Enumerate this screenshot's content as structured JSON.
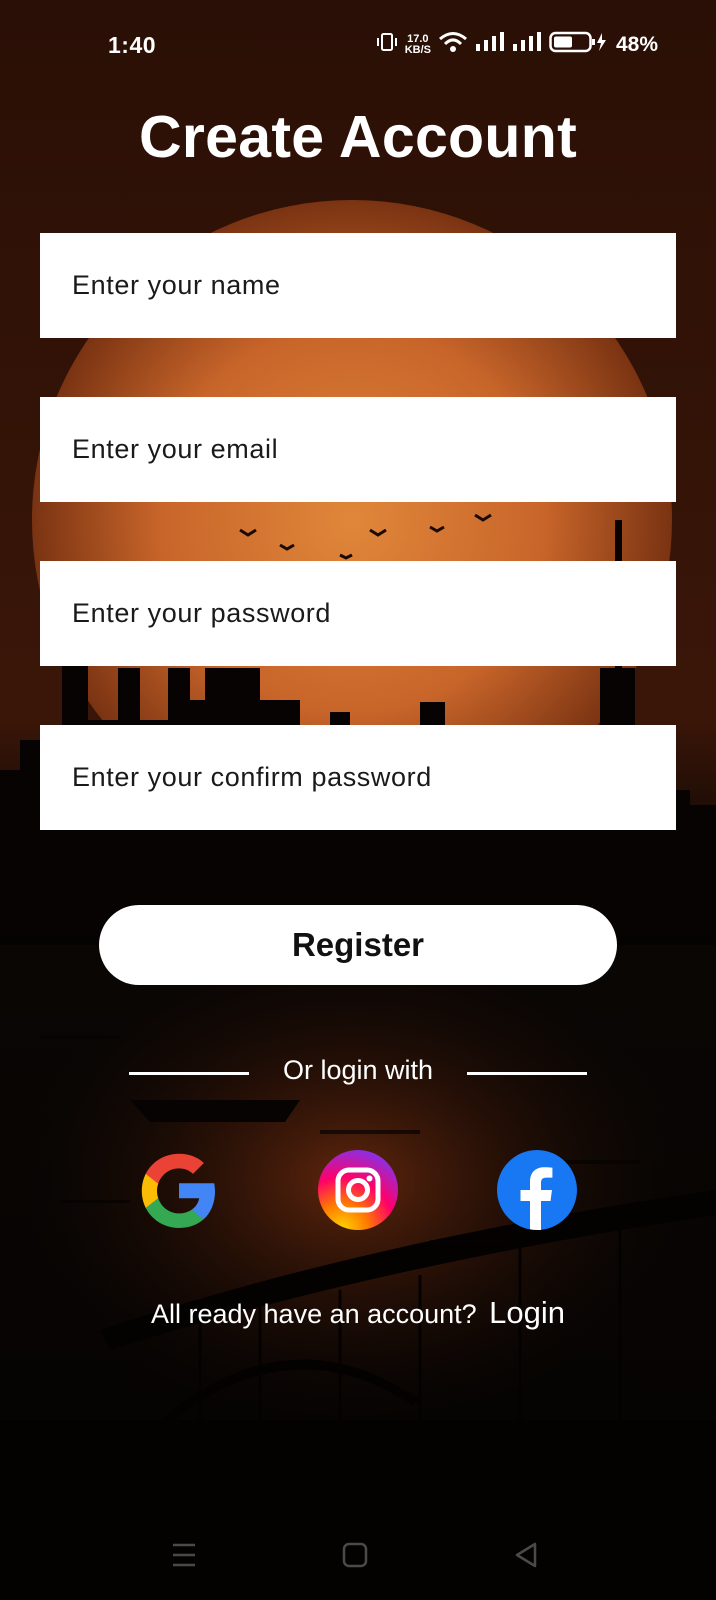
{
  "status_bar": {
    "time": "1:40",
    "net_speed_value": "17.0",
    "net_speed_unit": "KB/S",
    "battery_percent": "48%"
  },
  "page": {
    "title": "Create Account"
  },
  "form": {
    "name_placeholder": "Enter your name",
    "email_placeholder": "Enter your email",
    "password_placeholder": "Enter your password",
    "confirm_password_placeholder": "Enter your confirm password",
    "register_label": "Register"
  },
  "social": {
    "divider_text": "Or login with",
    "providers": [
      {
        "name": "google-icon",
        "color": "#4285F4"
      },
      {
        "name": "instagram-icon",
        "color": "#E1306C"
      },
      {
        "name": "facebook-icon",
        "color": "#1877F2"
      }
    ]
  },
  "footer": {
    "question": "All ready have an account?",
    "login_label": "Login"
  },
  "nav_bar": {
    "icons": [
      "menu-icon",
      "home-icon",
      "back-icon"
    ]
  },
  "colors": {
    "background_top": "#2a0f06",
    "sun": "#c8652a",
    "silhouette": "#050302",
    "text": "#ffffff"
  }
}
